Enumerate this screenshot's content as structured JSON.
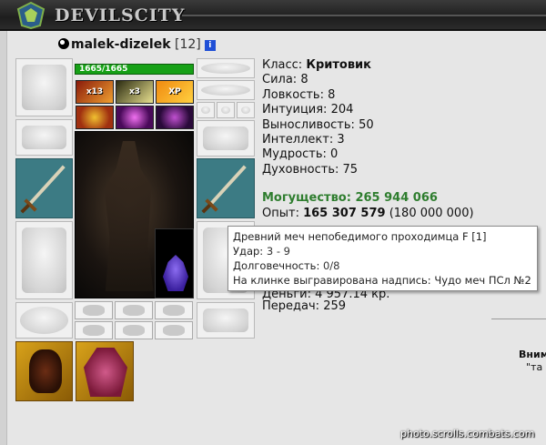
{
  "header": {
    "logo_text": "DEVILSCITY"
  },
  "character": {
    "nickname": "malek-dizelek",
    "level": "[12]",
    "info_badge": "i",
    "hp": "1665/1665"
  },
  "effects": [
    "x13",
    "x3",
    "XP"
  ],
  "stats": [
    {
      "label": "Класс:",
      "value": "Критовик",
      "bold": true
    },
    {
      "label": "Сила:",
      "value": "8"
    },
    {
      "label": "Ловкость:",
      "value": "8"
    },
    {
      "label": "Интуиция:",
      "value": "204"
    },
    {
      "label": "Выносливость:",
      "value": "50"
    },
    {
      "label": "Интеллект:",
      "value": "3"
    },
    {
      "label": "Мудрость:",
      "value": "0"
    },
    {
      "label": "Духовность:",
      "value": "75"
    }
  ],
  "power": {
    "label": "Могущество:",
    "value": "265 944 066"
  },
  "experience": {
    "label": "Опыт:",
    "value": "165 307 579",
    "next": "(180 000 000)"
  },
  "money": {
    "label": "Деньги:",
    "value": "4 957.14 кр."
  },
  "transfers": {
    "label": "Передач:",
    "value": "259"
  },
  "tooltip": {
    "title": "Древний меч непобедимого проходимца F [1]",
    "damage_label": "Удар:",
    "damage_value": "3 - 9",
    "durability_label": "Долговечность:",
    "durability_value": "0/8",
    "inscription": "На клинке выгравирована надпись: Чудо меч ПСл №2"
  },
  "side_notes": {
    "line1": "Вним",
    "line2": "\"та"
  },
  "watermark": "photo.scrolls.combats.com",
  "colors": {
    "hp_bar": "#16a016",
    "power_text": "#2e7d2e",
    "weapon_slot": "#3c7b84",
    "info_badge": "#1f4fd6"
  }
}
